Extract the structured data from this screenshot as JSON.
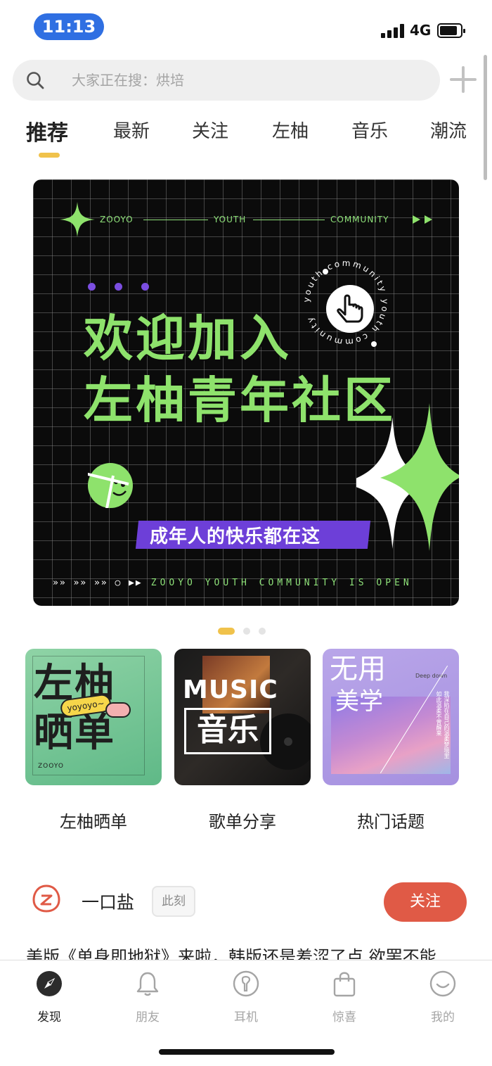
{
  "status_bar": {
    "time": "11:13",
    "network": "4G"
  },
  "search": {
    "placeholder": "大家正在搜：烘培"
  },
  "tabs": [
    "推荐",
    "最新",
    "关注",
    "左柚",
    "音乐",
    "潮流"
  ],
  "banner": {
    "top_line": [
      "ZOOYO",
      "YOUTH",
      "COMMUNITY"
    ],
    "title_line1": "欢迎加入",
    "title_line2": "左柚青年社区",
    "badge_ring_text": "youth community youth community",
    "tagline": "成年人的快乐都在这",
    "bottom_text": "ZOOYO YOUTH COMMUNITY IS OPEN"
  },
  "categories": [
    {
      "label": "左柚晒单",
      "art": [
        "左柚",
        "晒单",
        "yoyoyo~",
        "ZOOYO"
      ]
    },
    {
      "label": "歌单分享",
      "art": [
        "MUSIC",
        "音乐"
      ]
    },
    {
      "label": "热门话题",
      "art": [
        "无用",
        "美学",
        "Deep down",
        "我深陷在自己的温柔梦境里 如此温柔不曾醒来"
      ]
    }
  ],
  "post": {
    "author": "一口盐",
    "tag": "此刻",
    "follow_label": "关注",
    "text": "美版《单身即地狱》来啦，韩版还是羞涩了点 欲罢不能"
  },
  "bottom_nav": [
    {
      "label": "发现",
      "icon": "compass-icon",
      "active": true
    },
    {
      "label": "朋友",
      "icon": "bell-icon",
      "active": false
    },
    {
      "label": "耳机",
      "icon": "earphone-icon",
      "active": false
    },
    {
      "label": "惊喜",
      "icon": "gift-bag-icon",
      "active": false
    },
    {
      "label": "我的",
      "icon": "smiley-face-icon",
      "active": false
    }
  ],
  "colors": {
    "accent": "#f0c24b",
    "follow": "#e05a46",
    "banner_green": "#8ee26c",
    "banner_purple": "#6d3fd8",
    "time_pill": "#2f6fe2"
  }
}
